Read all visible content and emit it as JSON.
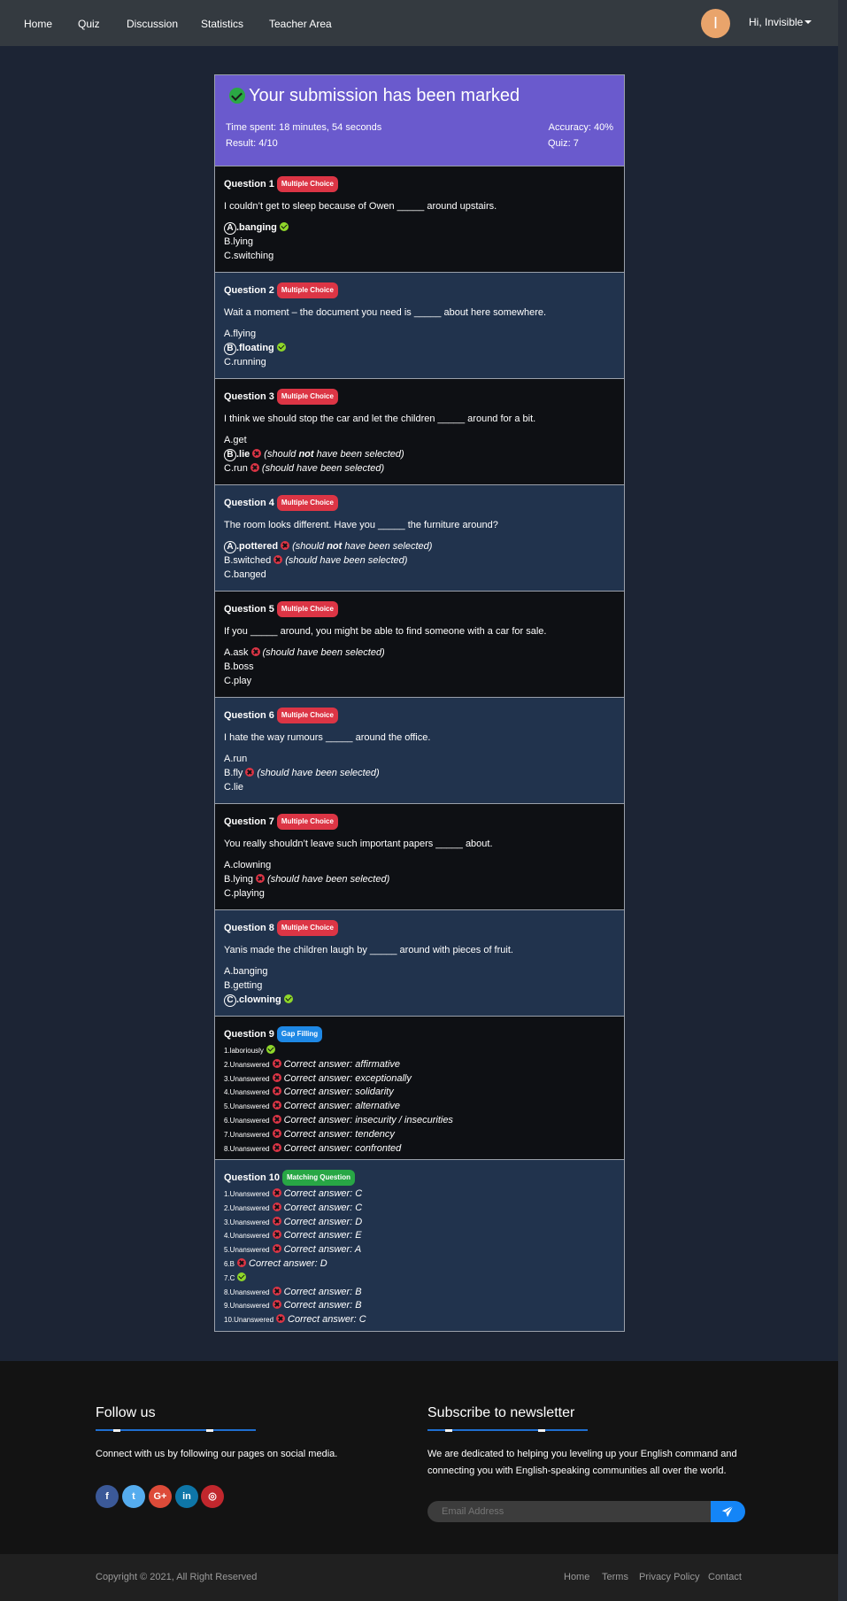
{
  "nav": {
    "links": [
      "Home",
      "Quiz",
      "Discussion",
      "Statistics",
      "Teacher Area"
    ],
    "avatar_letter": "I",
    "user": "Hi, Invisible"
  },
  "result": {
    "title": "Your submission has been marked",
    "time_spent": "Time spent: 18 minutes, 54 seconds",
    "result": "Result: 4/10",
    "accuracy": "Accuracy: 40%",
    "quiz": "Quiz: 7"
  },
  "questions": [
    {
      "title": "Question 1",
      "badge": "Multiple Choice",
      "text": "I couldn’t get to sleep because of Owen _____ around upstairs.",
      "options": [
        {
          "letter": "A",
          "label": ".banging",
          "selected": true,
          "mark": "ok"
        },
        {
          "label": "B.lying"
        },
        {
          "label": "C.switching"
        }
      ]
    },
    {
      "title": "Question 2",
      "badge": "Multiple Choice",
      "text": "Wait a moment – the document you need is _____ about here somewhere.",
      "options": [
        {
          "label": "A.flying"
        },
        {
          "letter": "B",
          "label": ".floating",
          "selected": true,
          "mark": "ok"
        },
        {
          "label": "C.running"
        }
      ]
    },
    {
      "title": "Question 3",
      "badge": "Multiple Choice",
      "text": "I think we should stop the car and let the children _____ around for a bit.",
      "options": [
        {
          "label": "A.get"
        },
        {
          "letter": "B",
          "label": ".lie",
          "selected": true,
          "mark": "bad",
          "note_pre": "(should ",
          "note_bold": "not",
          "note_post": " have been selected)"
        },
        {
          "label": "C.run",
          "mark": "bad",
          "note_pre": "(should have been selected)"
        }
      ]
    },
    {
      "title": "Question 4",
      "badge": "Multiple Choice",
      "text": "The room looks different. Have you _____ the furniture around?",
      "options": [
        {
          "letter": "A",
          "label": ".pottered",
          "selected": true,
          "mark": "bad",
          "note_pre": "(should ",
          "note_bold": "not",
          "note_post": " have been selected)"
        },
        {
          "label": "B.switched",
          "mark": "bad",
          "note_pre": "(should have been selected)"
        },
        {
          "label": "C.banged"
        }
      ]
    },
    {
      "title": "Question 5",
      "badge": "Multiple Choice",
      "text": "If you _____ around, you might be able to find someone with a car for sale.",
      "options": [
        {
          "label": "A.ask",
          "mark": "bad",
          "note_pre": "(should have been selected)"
        },
        {
          "label": "B.boss"
        },
        {
          "label": "C.play"
        }
      ]
    },
    {
      "title": "Question 6",
      "badge": "Multiple Choice",
      "text": "I hate the way rumours _____ around the office.",
      "options": [
        {
          "label": "A.run"
        },
        {
          "label": "B.fly",
          "mark": "bad",
          "note_pre": "(should have been selected)"
        },
        {
          "label": "C.lie"
        }
      ]
    },
    {
      "title": "Question 7",
      "badge": "Multiple Choice",
      "text": "You really shouldn’t leave such important papers _____ about.",
      "options": [
        {
          "label": "A.clowning"
        },
        {
          "label": "B.lying",
          "mark": "bad",
          "note_pre": "(should have been selected)"
        },
        {
          "label": "C.playing"
        }
      ]
    },
    {
      "title": "Question 8",
      "badge": "Multiple Choice",
      "text": "Yanis made the children laugh by _____ around with pieces of fruit.",
      "options": [
        {
          "label": "A.banging"
        },
        {
          "label": "B.getting"
        },
        {
          "letter": "C",
          "label": ".clowning",
          "selected": true,
          "mark": "ok"
        }
      ]
    }
  ],
  "gap_q": {
    "title": "Question 9",
    "badge": "Gap Filling",
    "items": [
      {
        "label": "1.laboriously",
        "mark": "ok"
      },
      {
        "label": "2.Unanswered",
        "mark": "bad",
        "answer": "Correct answer: affirmative"
      },
      {
        "label": "3.Unanswered",
        "mark": "bad",
        "answer": "Correct answer: exceptionally"
      },
      {
        "label": "4.Unanswered",
        "mark": "bad",
        "answer": "Correct answer: solidarity"
      },
      {
        "label": "5.Unanswered",
        "mark": "bad",
        "answer": "Correct answer: alternative"
      },
      {
        "label": "6.Unanswered",
        "mark": "bad",
        "answer": "Correct answer: insecurity / insecurities"
      },
      {
        "label": "7.Unanswered",
        "mark": "bad",
        "answer": "Correct answer: tendency"
      },
      {
        "label": "8.Unanswered",
        "mark": "bad",
        "answer": "Correct answer: confronted"
      }
    ]
  },
  "match_q": {
    "title": "Question 10",
    "badge": "Matching Question",
    "items": [
      {
        "label": "1.Unanswered",
        "mark": "bad",
        "answer": "Correct answer: C"
      },
      {
        "label": "2.Unanswered",
        "mark": "bad",
        "answer": "Correct answer: C"
      },
      {
        "label": "3.Unanswered",
        "mark": "bad",
        "answer": "Correct answer: D"
      },
      {
        "label": "4.Unanswered",
        "mark": "bad",
        "answer": "Correct answer: E"
      },
      {
        "label": "5.Unanswered",
        "mark": "bad",
        "answer": "Correct answer: A"
      },
      {
        "label": "6.B",
        "mark": "bad",
        "answer": "Correct answer: D"
      },
      {
        "label": "7.C",
        "mark": "ok"
      },
      {
        "label": "8.Unanswered",
        "mark": "bad",
        "answer": "Correct answer: B"
      },
      {
        "label": "9.Unanswered",
        "mark": "bad",
        "answer": "Correct answer: B"
      },
      {
        "label": "10.Unanswered",
        "mark": "bad",
        "answer": "Correct answer: C"
      }
    ]
  },
  "footer": {
    "follow_title": "Follow us",
    "follow_text": "Connect with us by following our pages on social media.",
    "social": [
      {
        "glyph": "f",
        "icon": "facebook-icon",
        "color": "#3b5998"
      },
      {
        "glyph": "t",
        "icon": "twitter-icon",
        "color": "#55acee"
      },
      {
        "glyph": "G+",
        "icon": "google-plus-icon",
        "color": "#dd4b39"
      },
      {
        "glyph": "in",
        "icon": "linkedin-icon",
        "color": "#0e76a8"
      },
      {
        "glyph": "◎",
        "icon": "instagram-icon",
        "color": "#c1272d"
      }
    ],
    "newsletter_title": "Subscribe to newsletter",
    "newsletter_text_1": "We are dedicated to helping you leveling up your English command and",
    "newsletter_text_2": "connecting you with English-speaking communities all over the world.",
    "email_placeholder": "Email Address",
    "copyright": "Copyright © 2021, All Right Reserved",
    "links": [
      "Home",
      "Terms",
      "Privacy Policy",
      "Contact"
    ]
  }
}
